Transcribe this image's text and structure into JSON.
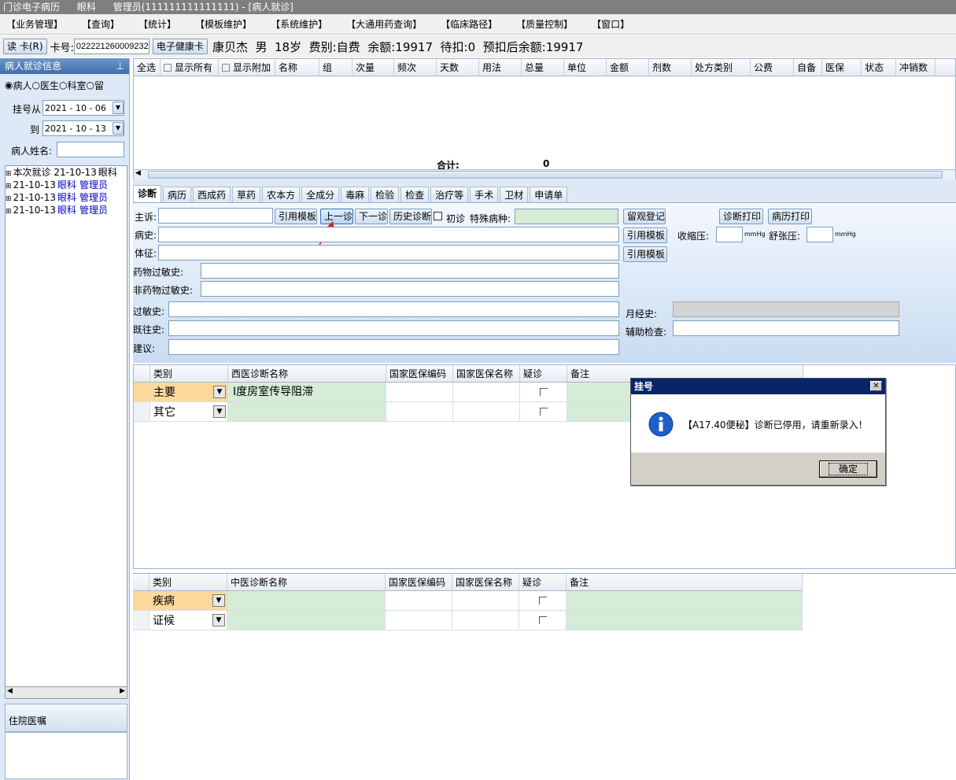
{
  "window": {
    "app": "门诊电子病历",
    "dept": "眼科",
    "user": "管理员(111111111111111) - [病人就诊]"
  },
  "menu": [
    "【业务管理】",
    "【查询】",
    "【统计】",
    "【模板维护】",
    "【系统维护】",
    "【大通用药查询】",
    "【临床路径】",
    "【质量控制】",
    "【窗口】"
  ],
  "cardbar": {
    "read_card": "读 卡(R)",
    "card_label": "卡号:",
    "card_value": "022221260009232",
    "ehealth": "电子健康卡",
    "patient_info": "康贝杰  男  18岁  费别:自费  余额:19917  待扣:0  预扣后余额:19917"
  },
  "left": {
    "header": "病人就诊信息",
    "radios": [
      "病人",
      "医生",
      "科室",
      "留"
    ],
    "reg_from_label": "挂号从",
    "reg_from": "2021 - 10 - 06",
    "to_label": "到",
    "reg_to": "2021 - 10 - 13",
    "name_label": "病人姓名:",
    "tree": [
      {
        "date": "本次就诊 21-10-13",
        "dept": "眼科",
        "who": ""
      },
      {
        "date": "21-10-13",
        "dept": "眼科",
        "who": "管理员"
      },
      {
        "date": "21-10-13",
        "dept": "眼科",
        "who": "管理员"
      },
      {
        "date": "21-10-13",
        "dept": "眼科",
        "who": "管理员"
      }
    ],
    "bottom_header": "住院医嘱"
  },
  "order_grid": {
    "select_all": "全选",
    "show_all": "显示所有",
    "show_extra": "显示附加",
    "columns": [
      "名称",
      "组",
      "次量",
      "频次",
      "天数",
      "用法",
      "总量",
      "单位",
      "金额",
      "剂数",
      "处方类别",
      "公费",
      "自备",
      "医保",
      "状态",
      "冲销数"
    ],
    "total_label": "合计:",
    "total_value": "0"
  },
  "tabs": [
    "诊断",
    "病历",
    "西成药",
    "草药",
    "农本方",
    "全成分",
    "毒麻",
    "检验",
    "检查",
    "治疗等",
    "手术",
    "卫材",
    "申请单"
  ],
  "form": {
    "chief": "主诉:",
    "ref_template": "引用模板",
    "prev_visit": "上一诊",
    "next_visit": "下一诊",
    "history_diag": "历史诊断",
    "first_visit": "初诊",
    "special_disease": "特殊病种:",
    "observe_reg": "留观登记",
    "diag_print": "诊断打印",
    "record_print": "病历打印",
    "history": "病史:",
    "systolic": "收缩压:",
    "diastolic": "舒张压:",
    "mmhg": "mmHg",
    "signs": "体征:",
    "drug_allergy": "药物过敏史:",
    "nondrug_allergy": "非药物过敏史:",
    "allergy": "过敏史:",
    "menstrual": "月经史:",
    "past_history": "既往史:",
    "aux_exam": "辅助检查:",
    "advice": "建议:"
  },
  "west_diag": {
    "columns": [
      "类别",
      "西医诊断名称",
      "国家医保编码",
      "国家医保名称",
      "疑诊",
      "备注"
    ],
    "rows": [
      {
        "type": "主要",
        "name": "Ⅰ度房室传导阻滞"
      },
      {
        "type": "其它",
        "name": ""
      }
    ]
  },
  "tcm_diag": {
    "columns": [
      "类别",
      "中医诊断名称",
      "国家医保编码",
      "国家医保名称",
      "疑诊",
      "备注"
    ],
    "rows": [
      {
        "type": "疾病",
        "name": ""
      },
      {
        "type": "证候",
        "name": ""
      }
    ]
  },
  "dialog": {
    "title": "挂号",
    "message": "【A17.40便秘】诊断已停用，请重新录入！",
    "ok": "确定"
  },
  "colors": {
    "accent": "#3f6ea8",
    "green_cell": "#d6ecd6",
    "highlight": "#fbd99b",
    "dialog_title": "#0a246a"
  }
}
